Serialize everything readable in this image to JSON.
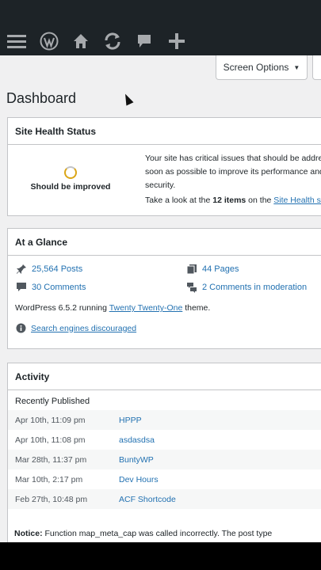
{
  "toolbar": {
    "icons": [
      "menu-icon",
      "wordpress-logo-icon",
      "home-icon",
      "updates-icon",
      "comments-icon",
      "add-new-icon"
    ]
  },
  "screen_options": {
    "label": "Screen Options",
    "arrow": "▼"
  },
  "page_title": "Dashboard",
  "site_health": {
    "title": "Site Health Status",
    "status": "Should be improved",
    "message": "Your site has critical issues that should be addressed as soon as possible to improve its performance and security.",
    "message_lines": [
      "Your site has critical issues that should be addre",
      "soon as possible to improve its performance and",
      "security."
    ],
    "take_look_prefix": "Take a look at the ",
    "items_count": "12 items",
    "take_look_mid": " on the ",
    "link_text": "Site Health sc"
  },
  "at_a_glance": {
    "title": "At a Glance",
    "posts": "25,564 Posts",
    "pages": "44 Pages",
    "comments": "30 Comments",
    "moderation": "2 Comments in moderation",
    "version_prefix": "WordPress 6.5.2 running ",
    "theme": "Twenty Twenty-One",
    "version_suffix": " theme.",
    "search_engines": "Search engines discouraged"
  },
  "activity": {
    "title": "Activity",
    "subtitle": "Recently Published",
    "rows": [
      {
        "date": "Apr 10th, 11:09 pm",
        "title": "HPPP"
      },
      {
        "date": "Apr 10th, 11:08 pm",
        "title": "asdasdsa"
      },
      {
        "date": "Mar 28th, 11:37 pm",
        "title": "BuntyWP"
      },
      {
        "date": "Mar 10th, 2:17 pm",
        "title": "Dev Hours"
      },
      {
        "date": "Feb 27th, 10:48 pm",
        "title": "ACF Shortcode"
      }
    ]
  },
  "notice": {
    "label": "Notice:",
    "text": " Function map_meta_cap was called incorrectly. The post type"
  },
  "colors": {
    "admin_bar": "#1d2327",
    "background": "#f0f0f1",
    "link": "#2271b1",
    "border": "#c3c4c7"
  }
}
